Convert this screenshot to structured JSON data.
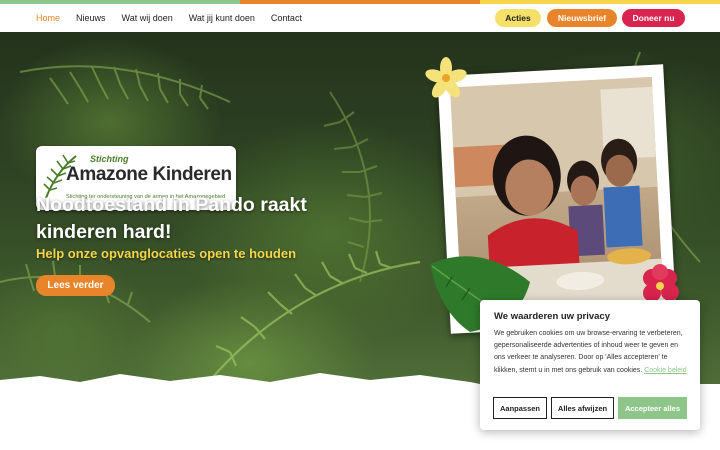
{
  "colors": {
    "strip": [
      "#8ec68a",
      "#e8842a",
      "#f5d54a"
    ],
    "accent_orange": "#e8842a",
    "accent_yellow": "#f5d54a",
    "accent_red": "#d8244e",
    "accent_green": "#8ec68a"
  },
  "nav": {
    "links": [
      "Home",
      "Nieuws",
      "Wat wij doen",
      "Wat jij kunt doen",
      "Contact"
    ],
    "active": "Home",
    "acties": "Acties",
    "nieuwsbrief": "Nieuwsbrief",
    "doneer": "Doneer nu"
  },
  "logo": {
    "stichting": "Stichting",
    "name": "Amazone Kinderen",
    "tagline": "Stichting ter ondersteuning van de armen in het Amazonegebied"
  },
  "hero": {
    "title": "Noodtoestand in Pando raakt kinderen hard!",
    "subtitle": "Help onze opvanglocaties open te houden",
    "button": "Lees verder"
  },
  "cookie": {
    "title": "We waarderen uw privacy",
    "body": "We gebruiken cookies om uw browse-ervaring te verbeteren, gepersonaliseerde advertenties of inhoud weer te geven en ons verkeer te analyseren. Door op 'Alles accepteren' te klikken, stemt u in met ons gebruik van cookies.",
    "link": "Cookie beleid",
    "customize": "Aanpassen",
    "reject": "Alles afwijzen",
    "accept": "Accepteer alles"
  },
  "icons": [
    "fern-leaf-logo-icon",
    "frangipani-flower-icon",
    "hibiscus-flower-icon",
    "monstera-leaf-icon"
  ]
}
